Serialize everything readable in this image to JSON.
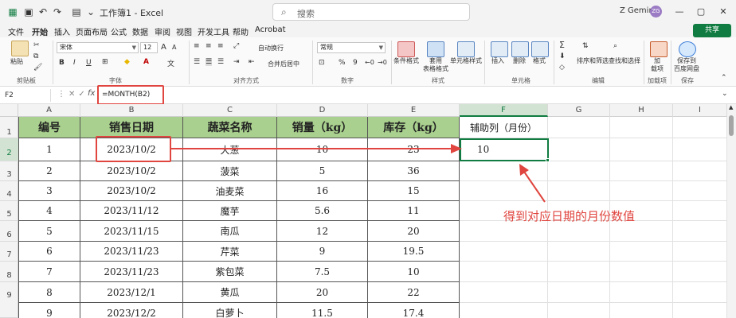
{
  "app": {
    "title": "工作簿1 - Excel",
    "search_placeholder": "搜索",
    "user_name": "Z Gemini",
    "user_initials": "ZG"
  },
  "tabs": [
    "文件",
    "开始",
    "插入",
    "页面布局",
    "公式",
    "数据",
    "审阅",
    "视图",
    "开发工具",
    "帮助",
    "Acrobat"
  ],
  "active_tab": "开始",
  "share_label": "共享",
  "ribbon": {
    "clipboard": {
      "paste": "粘贴",
      "group": "剪贴板"
    },
    "font": {
      "name": "宋体",
      "size": "12",
      "group": "字体",
      "bold": "B",
      "italic": "I",
      "underline": "U",
      "grow": "A",
      "shrink": "A"
    },
    "alignment": {
      "wrap": "自动换行",
      "merge": "合并后居中",
      "group": "对齐方式"
    },
    "number": {
      "format": "常规",
      "group": "数字",
      "percent": "%",
      "comma": "9"
    },
    "styles": {
      "cond": "条件格式",
      "table": "套用\n表格格式",
      "cell": "单元格样式",
      "group": "样式"
    },
    "cells": {
      "insert": "插入",
      "delete": "删除",
      "format": "格式",
      "group": "单元格"
    },
    "editing": {
      "sort": "排序和筛选",
      "find": "查找和选择",
      "group": "编辑",
      "sum": "Σ"
    },
    "addins": {
      "add": "加\n载项",
      "group": "加载项"
    },
    "save": {
      "label": "保存到\n百度网盘",
      "group": "保存"
    }
  },
  "formula_bar": {
    "name_box": "F2",
    "fx": "fx",
    "formula": "=MONTH(B2)"
  },
  "columns": [
    "A",
    "B",
    "C",
    "D",
    "E",
    "F",
    "G",
    "H",
    "I"
  ],
  "selected_column": "F",
  "row_numbers": [
    "1",
    "2",
    "3",
    "4",
    "5",
    "6",
    "7",
    "8",
    "9"
  ],
  "selected_row": "2",
  "table": {
    "headers": [
      "编号",
      "销售日期",
      "蔬菜名称",
      "销量（kg）",
      "库存（kg）"
    ],
    "rows": [
      [
        "1",
        "2023/10/2",
        "大葱",
        "10",
        "23"
      ],
      [
        "2",
        "2023/10/2",
        "菠菜",
        "5",
        "36"
      ],
      [
        "3",
        "2023/10/2",
        "油麦菜",
        "16",
        "15"
      ],
      [
        "4",
        "2023/11/12",
        "魔芋",
        "5.6",
        "11"
      ],
      [
        "5",
        "2023/11/15",
        "南瓜",
        "12",
        "20"
      ],
      [
        "6",
        "2023/11/23",
        "芹菜",
        "9",
        "19.5"
      ],
      [
        "7",
        "2023/11/23",
        "紫包菜",
        "7.5",
        "10"
      ],
      [
        "8",
        "2023/12/1",
        "黄瓜",
        "20",
        "22"
      ],
      [
        "9",
        "2023/12/2",
        "白萝卜",
        "11.5",
        "17.4"
      ]
    ]
  },
  "helper_column": {
    "header": "辅助列（月份）",
    "value": "10"
  },
  "annotation": "得到对应日期的月份数值",
  "colors": {
    "accent": "#107c41",
    "header_fill": "#a9d08e",
    "annotation": "#e0453f"
  }
}
